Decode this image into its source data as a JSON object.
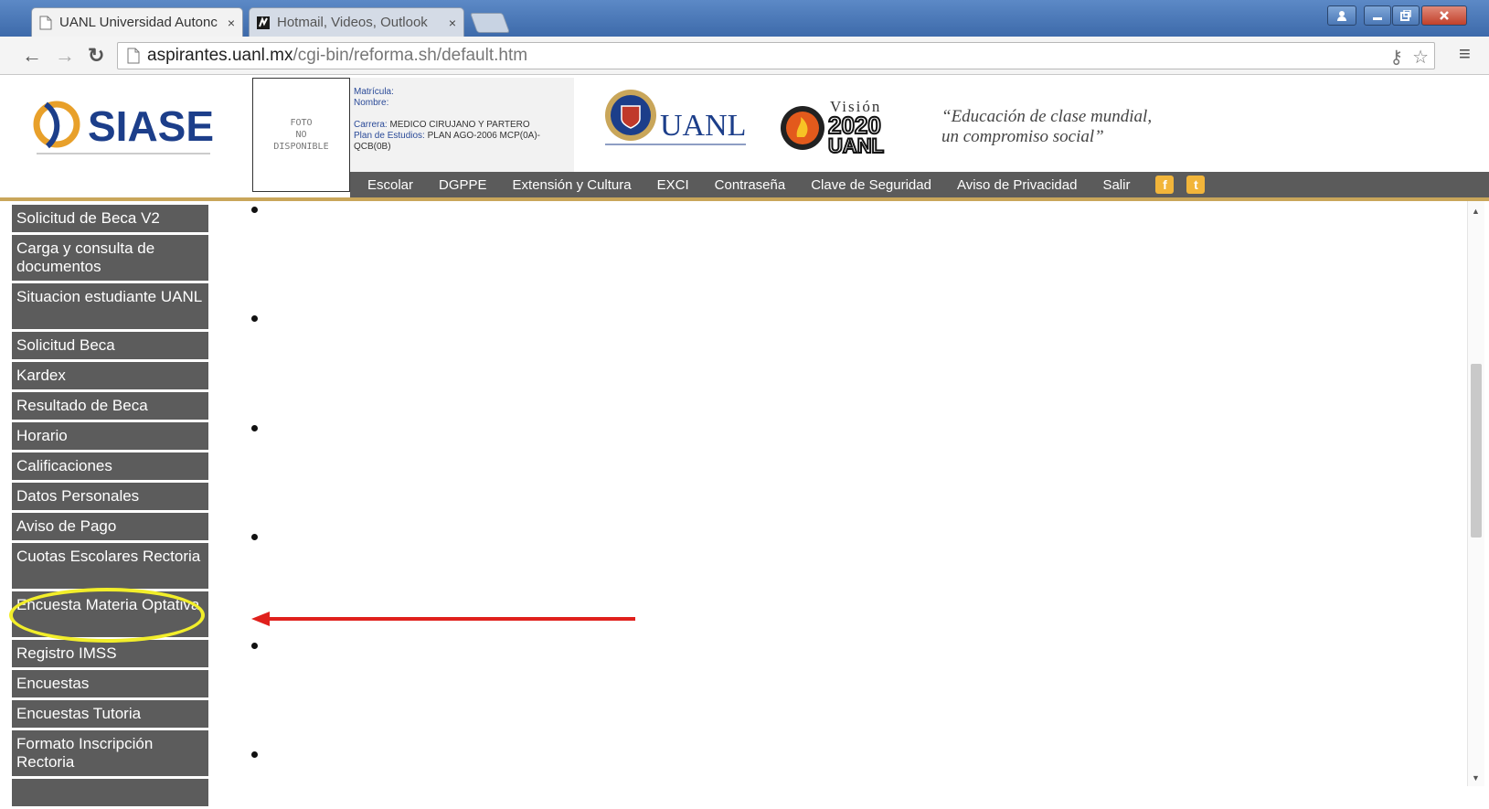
{
  "browser": {
    "tabs": [
      {
        "title": "UANL Universidad Autonc",
        "close": "×",
        "icon": "page-icon"
      },
      {
        "title": "Hotmail, Videos, Outlook",
        "close": "×",
        "icon": "msn-icon"
      }
    ],
    "url_host": "aspirantes.uanl.mx",
    "url_path": "/cgi-bin/reforma.sh/default.htm",
    "window_buttons": [
      "user-icon",
      "minimize-icon",
      "restore-icon",
      "close-icon"
    ]
  },
  "header": {
    "logo_text": "SIASE",
    "photo_text": "FOTO\nNO\nDISPONIBLE",
    "matricula_label": "Matrícula:",
    "nombre_label": "Nombre:",
    "carrera_label": "Carrera:",
    "carrera_value": "MEDICO CIRUJANO Y PARTERO",
    "plan_label": "Plan de Estudios:",
    "plan_value": "PLAN AGO-2006 MCP(0A)-QCB(0B)",
    "uanl_text": "UANL",
    "vision_word": "Visión",
    "vision_year": "2020",
    "vision_org": "UANL",
    "slogan": "“Educación de clase mundial,\n un compromiso social”"
  },
  "topnav": [
    "Escolar",
    "DGPPE",
    "Extensión y Cultura",
    "EXCI",
    "Contraseña",
    "Clave de Seguridad",
    "Aviso de Privacidad",
    "Salir"
  ],
  "sidebar": [
    {
      "label": "Solicitud de Beca V2",
      "lines": 1
    },
    {
      "label": "Carga y consulta de documentos",
      "lines": 2
    },
    {
      "label": "Situacion estudiante UANL",
      "lines": 2
    },
    {
      "label": "Solicitud Beca",
      "lines": 1
    },
    {
      "label": "Kardex",
      "lines": 1
    },
    {
      "label": "Resultado de Beca",
      "lines": 1
    },
    {
      "label": "Horario",
      "lines": 1
    },
    {
      "label": "Calificaciones",
      "lines": 1
    },
    {
      "label": "Datos Personales",
      "lines": 1
    },
    {
      "label": "Aviso de Pago",
      "lines": 1
    },
    {
      "label": "Cuotas Escolares Rectoria",
      "lines": 2
    },
    {
      "label": "Encuesta Materia Optativa",
      "lines": 2
    },
    {
      "label": "Registro IMSS",
      "lines": 1
    },
    {
      "label": "Encuestas",
      "lines": 1
    },
    {
      "label": "Encuestas Tutoria",
      "lines": 1
    },
    {
      "label": "Formato Inscripción Rectoria",
      "lines": 2
    }
  ],
  "colors": {
    "highlight": "#f2ee2a",
    "arrow": "#e0201c",
    "nav_bg": "#5b5b5b",
    "accent_line": "#c9a65a"
  }
}
